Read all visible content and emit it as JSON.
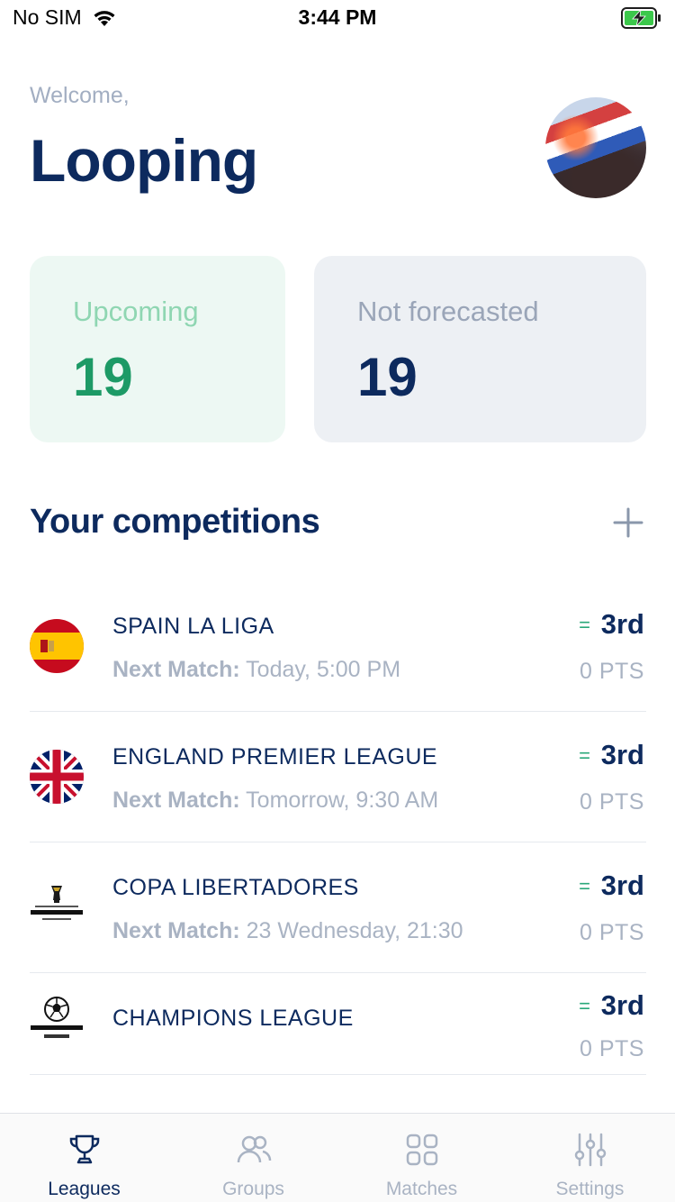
{
  "status_bar": {
    "carrier": "No SIM",
    "time": "3:44 PM"
  },
  "header": {
    "welcome": "Welcome,",
    "username": "Looping"
  },
  "stats": {
    "upcoming": {
      "label": "Upcoming",
      "value": "19"
    },
    "not_forecasted": {
      "label": "Not forecasted",
      "value": "19"
    }
  },
  "section": {
    "title": "Your competitions"
  },
  "competitions": [
    {
      "name": "SPAIN LA LIGA",
      "next_label": "Next Match:",
      "next_value": " Today, 5:00 PM",
      "trend": "=",
      "rank": "3rd",
      "points": "0 PTS",
      "icon": "spain-flag-icon"
    },
    {
      "name": "ENGLAND PREMIER LEAGUE",
      "next_label": "Next Match:",
      "next_value": " Tomorrow, 9:30 AM",
      "trend": "=",
      "rank": "3rd",
      "points": "0 PTS",
      "icon": "england-flag-icon"
    },
    {
      "name": "COPA LIBERTADORES",
      "next_label": "Next Match:",
      "next_value": " 23 Wednesday, 21:30",
      "trend": "=",
      "rank": "3rd",
      "points": "0 PTS",
      "icon": "copa-libertadores-logo-icon"
    },
    {
      "name": "CHAMPIONS LEAGUE",
      "trend": "=",
      "rank": "3rd",
      "points": "0 PTS",
      "icon": "champions-league-logo-icon"
    }
  ],
  "tabs": [
    {
      "label": "Leagues",
      "icon": "trophy-icon",
      "active": true
    },
    {
      "label": "Groups",
      "icon": "users-icon",
      "active": false
    },
    {
      "label": "Matches",
      "icon": "grid-icon",
      "active": false
    },
    {
      "label": "Settings",
      "icon": "sliders-icon",
      "active": false
    }
  ],
  "colors": {
    "primary": "#0d2a5e",
    "upcoming_bg": "#edf8f3",
    "upcoming_value": "#1d9a66",
    "muted": "#a9b3c3",
    "trend": "#2aa87a"
  }
}
